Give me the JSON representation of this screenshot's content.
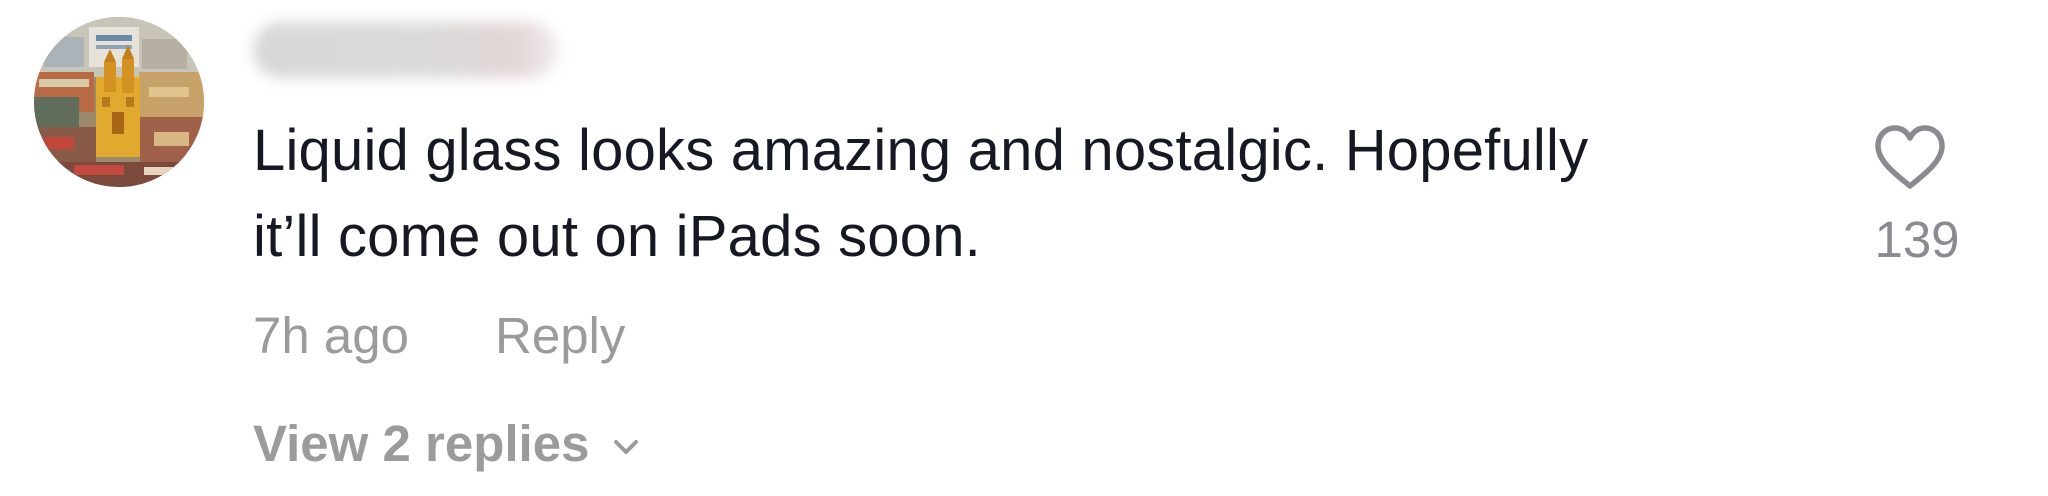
{
  "comment": {
    "text_line1": "Liquid glass looks amazing and nostalgic. Hopefully",
    "text_line2": "it’ll come out on iPads soon.",
    "timestamp": "7h ago",
    "reply_label": "Reply",
    "view_replies_label": "View 2 replies",
    "like_count": "139",
    "like_icon": "heart-outline-icon",
    "expand_icon": "chevron-down-icon"
  },
  "colors": {
    "text_primary": "#161823",
    "text_secondary": "#9b9b9e",
    "icon_gray": "#8a8b91"
  }
}
